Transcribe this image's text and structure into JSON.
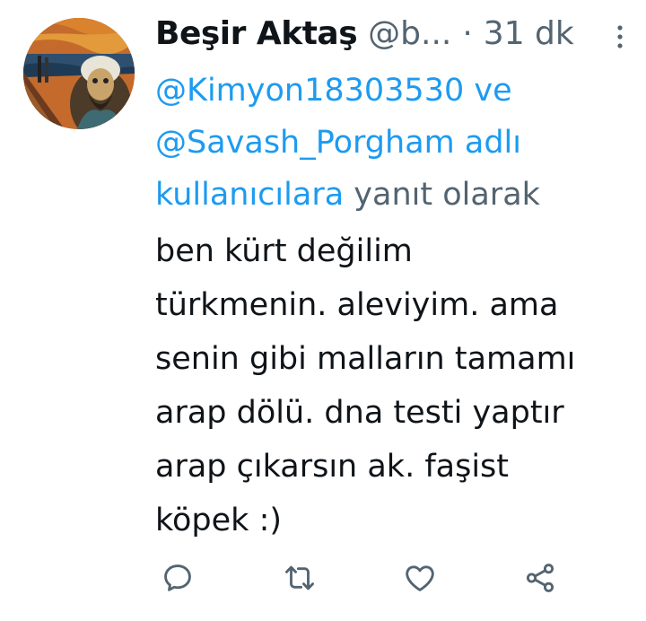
{
  "tweet": {
    "author": {
      "display_name": "Beşir Aktaş",
      "handle": "@b...",
      "avatar_icon": "avatar-image"
    },
    "separator": "·",
    "time": "31 dk",
    "reply_context": {
      "mention_1": "@Kimyon18303530",
      "joiner": "ve",
      "mention_2": "@Savash_Porgham",
      "suffix_link": "adlı kullanıcılara",
      "suffix_text": "yanıt olarak"
    },
    "body": "ben kürt değilim\ntürkmenin. aleviyim. ama\nsenin gibi malların tamamı\narap dölü. dna testi yaptır\narap çıkarsın ak. faşist\nköpek :)",
    "actions": {
      "reply_icon": "reply-icon",
      "retweet_icon": "retweet-icon",
      "like_icon": "heart-icon",
      "share_icon": "share-icon"
    },
    "colors": {
      "link": "#1d9bf0",
      "secondary_text": "#536471",
      "primary_text": "#0f1419",
      "icon": "#536471"
    }
  }
}
